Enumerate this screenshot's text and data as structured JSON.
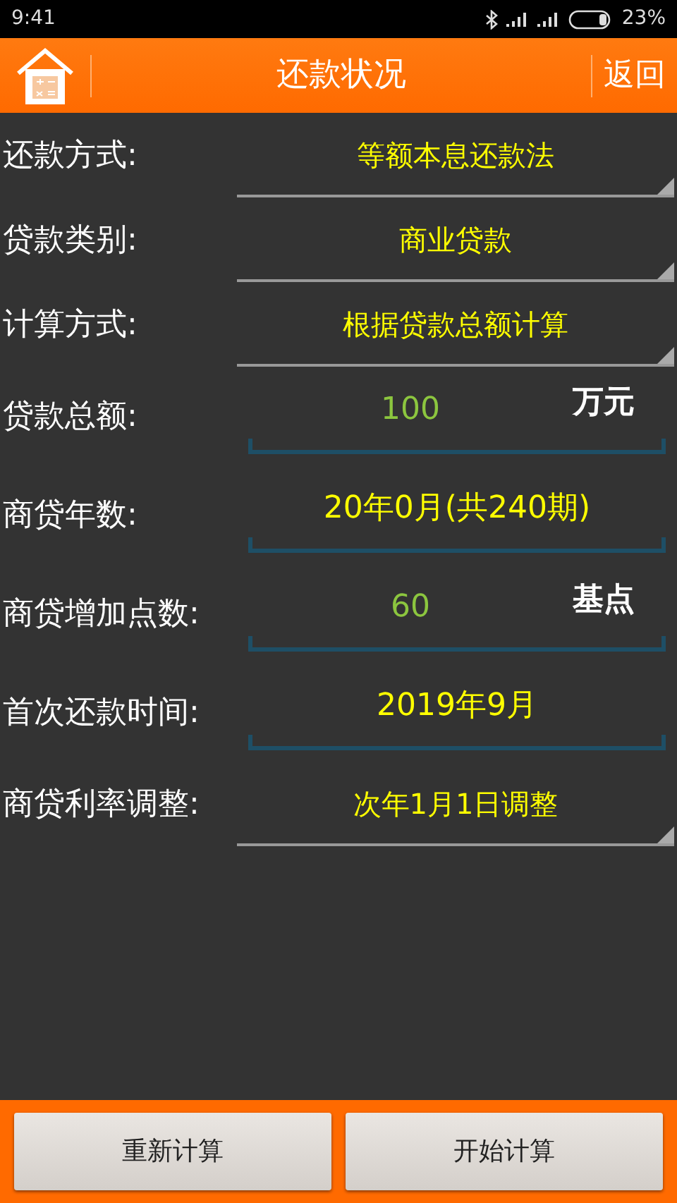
{
  "status_bar": {
    "time": "9:41",
    "battery": "23%"
  },
  "header": {
    "title": "还款状况",
    "back": "返回"
  },
  "rows": [
    {
      "kind": "spinner",
      "label": "还款方式:",
      "value": "等额本息还款法"
    },
    {
      "kind": "spinner",
      "label": "贷款类别:",
      "value": "商业贷款"
    },
    {
      "kind": "spinner",
      "label": "计算方式:",
      "value": "根据贷款总额计算"
    },
    {
      "kind": "input",
      "label": "贷款总额:",
      "value": "100",
      "unit": "万元"
    },
    {
      "kind": "picker",
      "label": "商贷年数:",
      "value": "20年0月(共240期)"
    },
    {
      "kind": "input",
      "label": "商贷增加点数:",
      "value": "60",
      "unit": "基点"
    },
    {
      "kind": "picker",
      "label": "首次还款时间:",
      "value": "2019年9月"
    },
    {
      "kind": "spinner",
      "label": "商贷利率调整:",
      "value": "次年1月1日调整"
    }
  ],
  "buttons": [
    "重新计算",
    "开始计算"
  ]
}
